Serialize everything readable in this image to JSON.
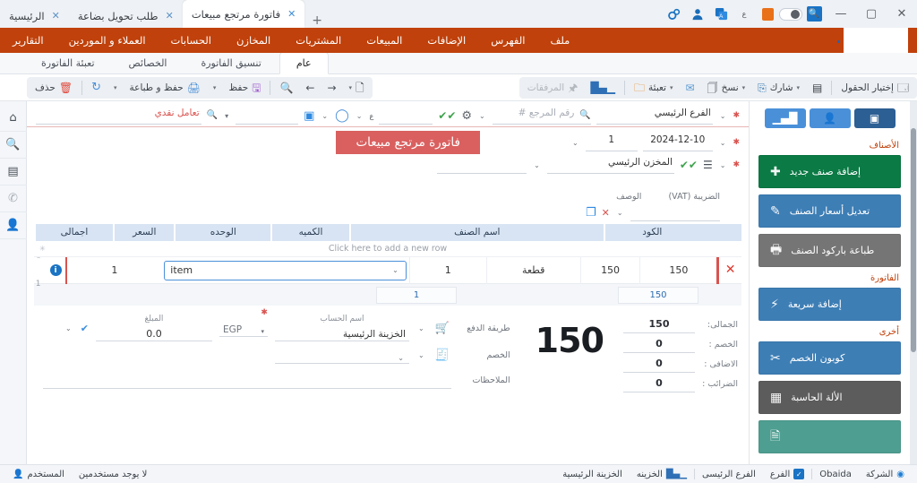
{
  "window": {
    "close": "✕",
    "maximize": "▢",
    "minimize": "—",
    "search_icon": "search-icon",
    "toggle": "toggle-switch",
    "orange_icon": "menu-icon",
    "small_label": "ع",
    "translate_icon": "translate-icon",
    "user_icon": "user-icon",
    "settings_icon": "settings-icon"
  },
  "tabs": {
    "items": [
      {
        "label": "فاتورة مرتجع مبيعات",
        "active": true
      },
      {
        "label": "طلب تحويل بضاعة",
        "active": false
      },
      {
        "label": "الرئيسية",
        "active": false
      }
    ],
    "new_tab": "+"
  },
  "menubar": {
    "items": [
      "ملف",
      "الفهرس",
      "الإضافات",
      "المبيعات",
      "المشتريات",
      "المخازن",
      "الحسابات",
      "العملاء و الموردين",
      "التقارير"
    ]
  },
  "ribbon_tabs": {
    "items": [
      {
        "label": "عام",
        "active": true
      },
      {
        "label": "تنسيق الفاتورة",
        "active": false
      },
      {
        "label": "الخصائص",
        "active": false
      },
      {
        "label": "تعبئة الفاتورة",
        "active": false
      }
    ]
  },
  "toolbar_right": {
    "new": {
      "label": "",
      "icon": "new-document-icon"
    },
    "forward": {
      "label": "",
      "icon": "arrow-forward-icon"
    },
    "back": {
      "label": "",
      "icon": "arrow-back-icon"
    },
    "search": {
      "label": "",
      "icon": "search-records-icon"
    },
    "save": {
      "label": "حفظ",
      "icon": "save-icon"
    },
    "save_print": {
      "label": "حفظ و طباعة",
      "icon": "save-print-icon"
    },
    "refresh": {
      "label": "",
      "icon": "refresh-icon"
    },
    "delete": {
      "label": "حذف",
      "icon": "trash-icon"
    }
  },
  "toolbar_left": {
    "attachments": {
      "label": "المرفقات",
      "icon": "paperclip-icon"
    },
    "chart": {
      "label": "",
      "icon": "bar-chart-icon"
    },
    "fill": {
      "label": "تعبئة",
      "icon": "folder-icon"
    },
    "mail": {
      "label": "",
      "icon": "mail-icon"
    },
    "copy": {
      "label": "نسخ",
      "icon": "copy-icon"
    },
    "share": {
      "label": "شارك",
      "icon": "share-icon"
    },
    "keyboard": {
      "label": "",
      "icon": "keyboard-icon"
    },
    "choose_fields": {
      "label": "إختيار الحقول",
      "icon": "columns-icon"
    }
  },
  "right_rail": {
    "items": [
      {
        "name": "home-icon",
        "glyph": "⌂"
      },
      {
        "name": "search-icon",
        "glyph": "🔍"
      },
      {
        "name": "report-icon",
        "glyph": "▤"
      },
      {
        "name": "phone-icon",
        "glyph": "✆"
      },
      {
        "name": "user-icon",
        "glyph": "👤"
      }
    ]
  },
  "sidebar": {
    "toggles": [
      {
        "name": "stats-toggle",
        "glyph": "▁▄█",
        "active": false
      },
      {
        "name": "contacts-toggle",
        "glyph": "👤",
        "active": false
      },
      {
        "name": "layout-toggle",
        "glyph": "▣",
        "active": true
      }
    ],
    "sections": [
      {
        "heading": "الأصناف",
        "buttons": [
          {
            "label": "إضافة صنف جديد",
            "icon": "plus-circle-icon",
            "glyph": "✚",
            "color": "#0b7a45"
          },
          {
            "label": "تعديل أسعار الصنف",
            "icon": "pencil-icon",
            "glyph": "✎",
            "color": "#3d7eb5"
          },
          {
            "label": "طباعة باركود الصنف",
            "icon": "printer-icon",
            "glyph": "🖶",
            "color": "#757575"
          }
        ]
      },
      {
        "heading": "الفاتورة",
        "buttons": [
          {
            "label": "إضافة سريعة",
            "icon": "lightning-icon",
            "glyph": "⚡",
            "color": "#3d7eb5"
          }
        ]
      },
      {
        "heading": "أخرى",
        "buttons": [
          {
            "label": "كوبون الخصم",
            "icon": "scissors-icon",
            "glyph": "✂",
            "color": "#3d7eb5"
          },
          {
            "label": "الألة الحاسبة",
            "icon": "calculator-icon",
            "glyph": "▦",
            "color": "#5c5c5c"
          },
          {
            "label": "",
            "icon": "document-icon",
            "glyph": "🗎",
            "color": "#4e9e91"
          }
        ]
      }
    ]
  },
  "form": {
    "banner_title": "فاتورة مرتجع مبيعات",
    "cash_deal": "تعامل نقدي",
    "branch": "الفرع الرئيسي",
    "reference_placeholder": "رقم المرجع #",
    "currency_small": "ع",
    "date": "2024-12-10",
    "invoice_no": "1",
    "warehouse": "المخزن الرئيسي",
    "vat_label": "الضريبة (VAT)",
    "description_label": "الوصف"
  },
  "table": {
    "headers": [
      "الكود",
      "اسم الصنف",
      "الكميه",
      "الوحده",
      "السعر",
      "اجمالى"
    ],
    "add_row_hint": "Click here to add a new row",
    "rows": [
      {
        "index": "1",
        "code": "1",
        "name": "item",
        "qty": "1",
        "unit": "قطعة",
        "price": "150",
        "total": "150",
        "delete_icon": "delete-row-icon",
        "info_icon": "info-icon"
      }
    ],
    "summary": {
      "qty": "1",
      "total": "150"
    }
  },
  "totals": {
    "lines": [
      {
        "label": "الجمالى:",
        "value": "150"
      },
      {
        "label": "الخصم :",
        "value": "0"
      },
      {
        "label": "الاضافى :",
        "value": "0"
      },
      {
        "label": "الضرائب :",
        "value": "0"
      }
    ],
    "grand_total": "150"
  },
  "payment": {
    "method_label": "طريقة الدفع",
    "account_label": "اسم الحساب",
    "account_value": "الخزينة الرئيسية",
    "currency": "EGP",
    "amount_label": "المبلغ",
    "amount_value": "0.0",
    "discount_label": "الخصم",
    "notes_label": "الملاحظات",
    "cart_icon": "cart-icon",
    "discount_icon": "discount-icon"
  },
  "statusbar": {
    "company_label": "الشركة",
    "company_value": "Obaida",
    "branch_label": "الفرع",
    "branch_value": "الفرع الرئيسى",
    "treasury_label": "الخزينه",
    "treasury_value": "الخزينة الرئيسية",
    "user_label": "المستخدم",
    "user_value": "لا يوجد مستخدمين"
  },
  "colors": {
    "brand_orange": "#c0410b",
    "banner_red": "#d9605f",
    "accent_blue": "#4a90d9",
    "header_blue": "#d8e4f3"
  }
}
